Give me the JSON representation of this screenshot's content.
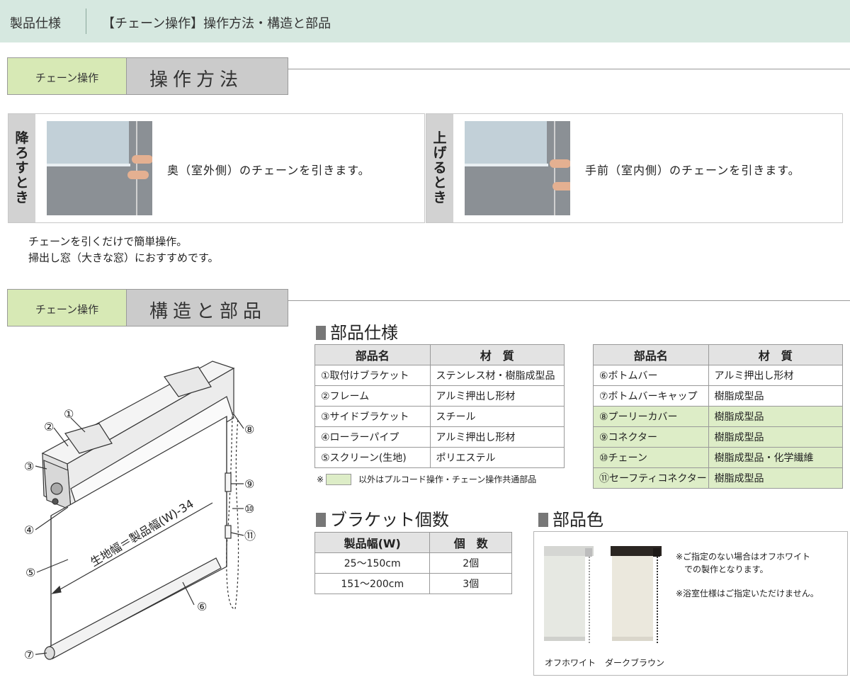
{
  "header": {
    "category": "製品仕様",
    "title": "【チェーン操作】操作方法・構造と部品"
  },
  "section_operation": {
    "tag": "チェーン操作",
    "title": "操作方法"
  },
  "operation_lower": {
    "label_chars": [
      "降",
      "ろ",
      "す",
      "と",
      "き"
    ],
    "text": "奥（室外側）のチェーンを引きます。"
  },
  "operation_raise": {
    "label_chars": [
      "上",
      "げ",
      "る",
      "と",
      "き"
    ],
    "text": "手前（室内側）のチェーンを引きます。"
  },
  "operation_notes": [
    "チェーンを引くだけで簡単操作。",
    "掃出し窓（大きな窓）におすすめです。"
  ],
  "section_structure": {
    "tag": "チェーン操作",
    "title": "構造と部品"
  },
  "diagram": {
    "dimension_label": "生地幅＝製品幅(W)-34",
    "callouts": [
      "①",
      "②",
      "③",
      "④",
      "⑤",
      "⑥",
      "⑦",
      "⑧",
      "⑨",
      "⑩",
      "⑪"
    ]
  },
  "parts_spec": {
    "title": "部品仕様",
    "headers": [
      "部品名",
      "材　質"
    ],
    "left_rows": [
      {
        "name": "①取付けブラケット",
        "material": "ステンレス材・樹脂成型品"
      },
      {
        "name": "②フレーム",
        "material": "アルミ押出し形材"
      },
      {
        "name": "③サイドブラケット",
        "material": "スチール"
      },
      {
        "name": "④ローラーパイプ",
        "material": "アルミ押出し形材"
      },
      {
        "name": "⑤スクリーン(生地)",
        "material": "ポリエステル"
      }
    ],
    "right_rows": [
      {
        "name": "⑥ボトムバー",
        "material": "アルミ押出し形材"
      },
      {
        "name": "⑦ボトムバーキャップ",
        "material": "樹脂成型品"
      },
      {
        "name": "⑧プーリーカバー",
        "material": "樹脂成型品"
      },
      {
        "name": "⑨コネクター",
        "material": "樹脂成型品"
      },
      {
        "name": "⑩チェーン",
        "material": "樹脂成型品・化学繊維"
      },
      {
        "name": "⑪セーフティコネクター",
        "material": "樹脂成型品"
      }
    ],
    "legend_prefix": "※",
    "legend_text": "以外はプルコード操作・チェーン操作共通部品",
    "highlight_color": "#ddedc7"
  },
  "bracket_count": {
    "title": "ブラケット個数",
    "headers": [
      "製品幅(W)",
      "個　数"
    ],
    "rows": [
      {
        "width": "25～150cm",
        "count": "2個"
      },
      {
        "width": "151～200cm",
        "count": "3個"
      }
    ]
  },
  "part_color": {
    "title": "部品色",
    "options": [
      "オフホワイト",
      "ダークブラウン"
    ],
    "notes": [
      "※ご指定のない場合はオフホワイト",
      "での製作となります。",
      "※浴室仕様はご指定いただけません。"
    ]
  }
}
